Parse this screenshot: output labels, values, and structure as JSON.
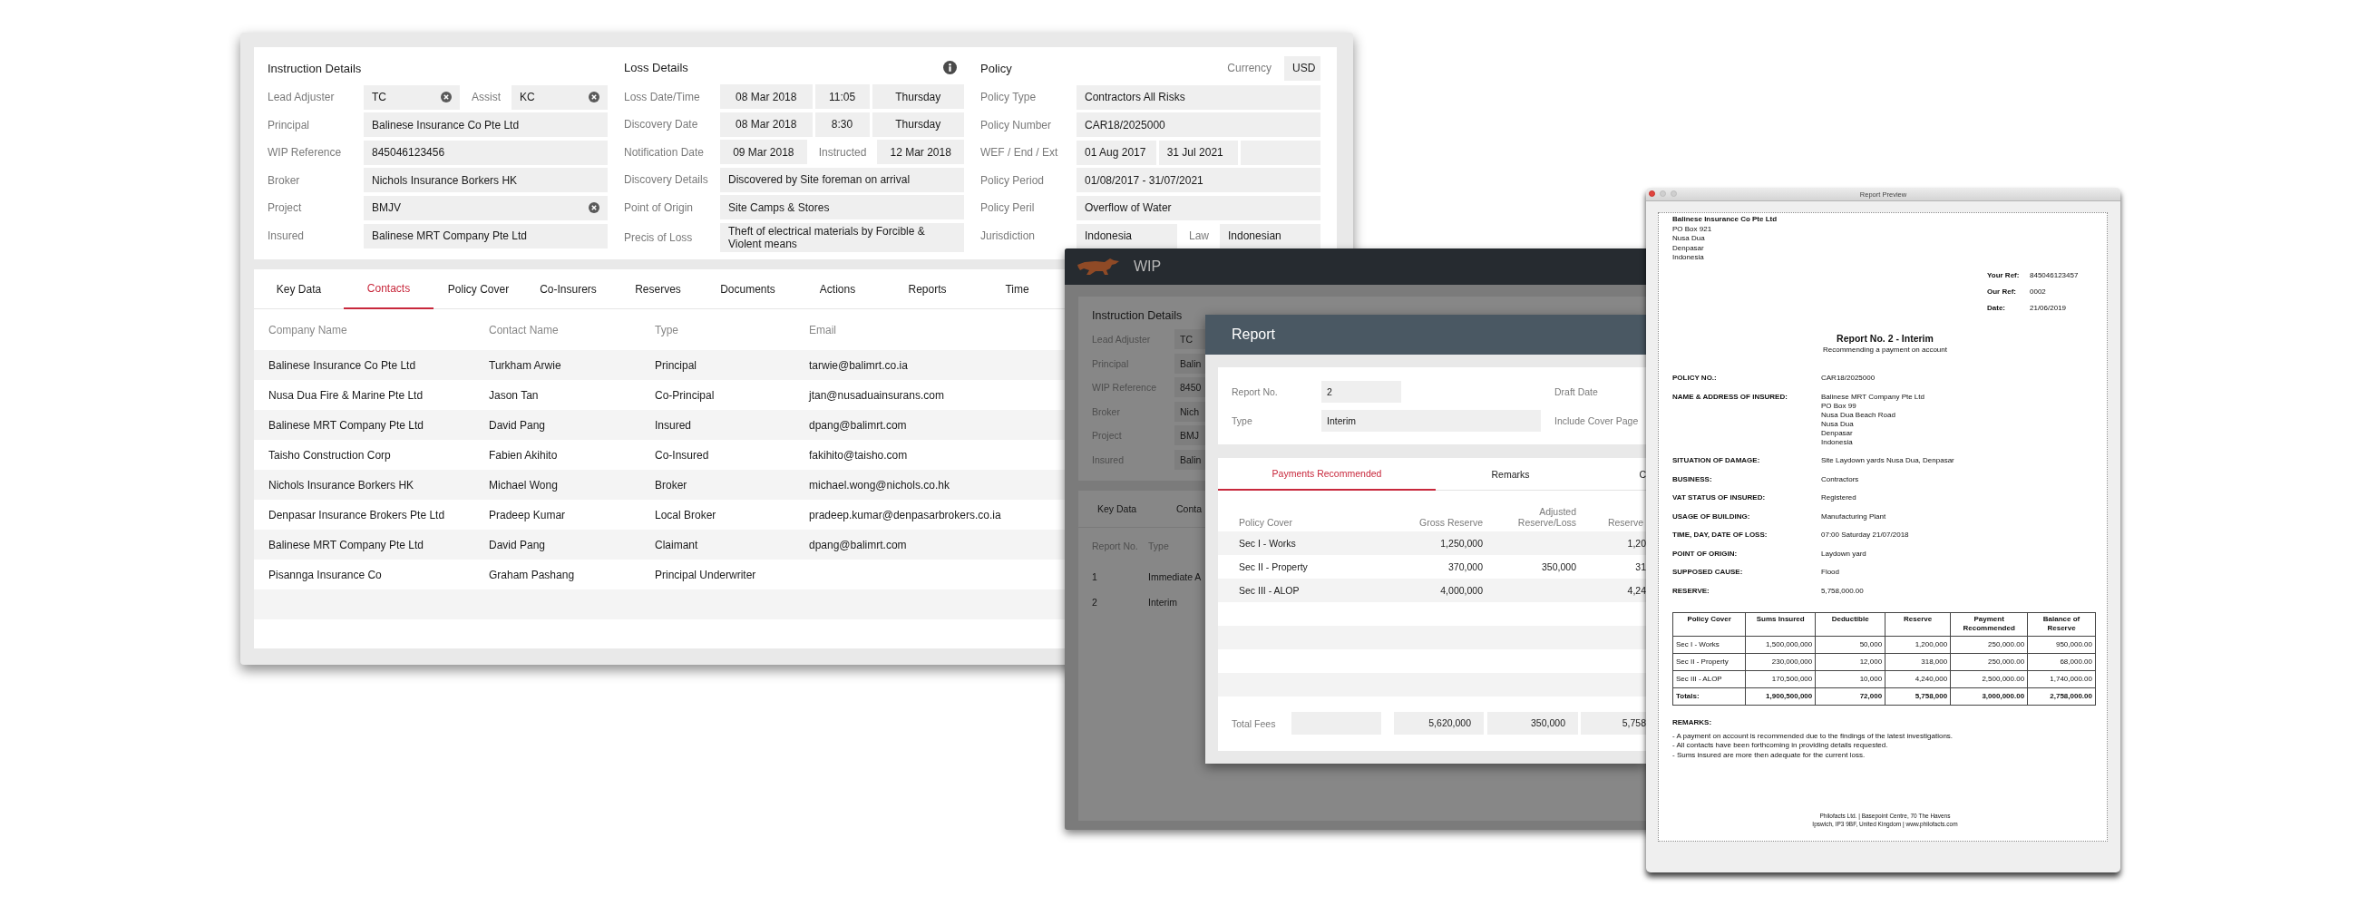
{
  "claim_window": {
    "sections": [
      {
        "kind": "instruction",
        "title": "Instruction Details",
        "rows": [
          {
            "label": "Lead Adjuster",
            "parts": [
              {
                "kind": "field",
                "value": "TC",
                "clearable": true
              },
              {
                "kind": "label",
                "text": "Assist"
              },
              {
                "kind": "field",
                "value": "KC",
                "clearable": true
              }
            ]
          },
          {
            "label": "Principal",
            "parts": [
              {
                "kind": "field",
                "value": "Balinese Insurance Co Pte Ltd",
                "clearable": false
              }
            ]
          },
          {
            "label": "WIP Reference",
            "parts": [
              {
                "kind": "field",
                "value": "845046123456",
                "clearable": false
              }
            ]
          },
          {
            "label": "Broker",
            "parts": [
              {
                "kind": "field",
                "value": "Nichols Insurance Borkers HK",
                "clearable": false
              }
            ]
          },
          {
            "label": "Project",
            "parts": [
              {
                "kind": "field",
                "value": "BMJV",
                "clearable": true
              }
            ]
          },
          {
            "label": "Insured",
            "parts": [
              {
                "kind": "field",
                "value": "Balinese MRT Company Pte Ltd",
                "clearable": false
              }
            ]
          }
        ]
      },
      {
        "kind": "loss",
        "title": "Loss Details",
        "header_extras": [
          {
            "kind": "info"
          }
        ],
        "rows": [
          {
            "label": "Loss Date/Time",
            "parts": [
              {
                "kind": "field",
                "value": "08 Mar 2018",
                "clearable": false
              },
              {
                "kind": "field",
                "value": "11:05",
                "clearable": false
              },
              {
                "kind": "field",
                "value": "Thursday",
                "clearable": false
              }
            ]
          },
          {
            "label": "Discovery Date",
            "parts": [
              {
                "kind": "field",
                "value": "08 Mar 2018",
                "clearable": false
              },
              {
                "kind": "field",
                "value": "8:30",
                "clearable": false
              },
              {
                "kind": "field",
                "value": "Thursday",
                "clearable": false
              }
            ]
          },
          {
            "label": "Notification Date",
            "parts": [
              {
                "kind": "field",
                "value": "09 Mar 2018",
                "clearable": false
              },
              {
                "kind": "label",
                "text": "Instructed"
              },
              {
                "kind": "field",
                "value": "12 Mar 2018",
                "clearable": false
              }
            ]
          },
          {
            "label": "Discovery Details",
            "parts": [
              {
                "kind": "field",
                "value": "Discovered by Site foreman on arrival",
                "clearable": false
              }
            ]
          },
          {
            "label": "Point of Origin",
            "parts": [
              {
                "kind": "field",
                "value": "Site Camps & Stores",
                "clearable": false
              }
            ]
          },
          {
            "label": "Precis of Loss",
            "parts": [
              {
                "kind": "field",
                "value": "Theft of electrical materials by Forcible & Violent means",
                "clearable": false
              }
            ]
          }
        ]
      },
      {
        "kind": "policy",
        "title": "Policy",
        "header_extras": [
          {
            "kind": "label",
            "text": "Currency"
          },
          {
            "kind": "field",
            "value": "USD",
            "clearable": false
          }
        ],
        "rows": [
          {
            "label": "Policy Type",
            "parts": [
              {
                "kind": "field",
                "value": "Contractors All Risks",
                "clearable": false
              }
            ]
          },
          {
            "label": "Policy Number",
            "parts": [
              {
                "kind": "field",
                "value": "CAR18/2025000",
                "clearable": false
              }
            ]
          },
          {
            "label": "WEF / End / Ext",
            "parts": [
              {
                "kind": "field",
                "value": "01 Aug 2017",
                "clearable": false
              },
              {
                "kind": "field",
                "value": "31 Jul 2021",
                "clearable": false
              },
              {
                "kind": "field",
                "clearable": false
              }
            ]
          },
          {
            "label": "Policy Period",
            "parts": [
              {
                "kind": "field",
                "value": "01/08/2017 - 31/07/2021",
                "clearable": false
              }
            ]
          },
          {
            "label": "Policy Peril",
            "parts": [
              {
                "kind": "field",
                "value": "Overflow of Water",
                "clearable": false
              }
            ]
          },
          {
            "label": "Jurisdiction",
            "parts": [
              {
                "kind": "field",
                "value": "Indonesia",
                "clearable": false
              },
              {
                "kind": "label",
                "text": "Law"
              },
              {
                "kind": "field",
                "value": "Indonesian",
                "clearable": false
              }
            ]
          }
        ]
      }
    ],
    "tabs": [
      {
        "label": "Key Data",
        "selected": false
      },
      {
        "label": "Contacts",
        "selected": true
      },
      {
        "label": "Policy Cover",
        "selected": false
      },
      {
        "label": "Co-Insurers",
        "selected": false
      },
      {
        "label": "Reserves",
        "selected": false
      },
      {
        "label": "Documents",
        "selected": false
      },
      {
        "label": "Actions",
        "selected": false
      },
      {
        "label": "Reports",
        "selected": false
      },
      {
        "label": "Time",
        "selected": false
      }
    ],
    "contacts_table": {
      "columns": [
        "Company Name",
        "Contact Name",
        "Type",
        "Email"
      ],
      "rows": [
        {
          "company": "Balinese Insurance Co Pte Ltd",
          "contact": "Turkham Arwie",
          "type": "Principal",
          "email": "tarwie@balimrt.co.ia"
        },
        {
          "company": "Nusa Dua Fire & Marine Pte Ltd",
          "contact": "Jason Tan",
          "type": "Co-Principal",
          "email": "jtan@nusaduainsurans.com"
        },
        {
          "company": "Balinese MRT Company Pte Ltd",
          "contact": "David Pang",
          "type": "Insured",
          "email": "dpang@balimrt.com"
        },
        {
          "company": "Taisho Construction Corp",
          "contact": "Fabien Akihito",
          "type": "Co-Insured",
          "email": "fakihito@taisho.com"
        },
        {
          "company": "Nichols Insurance Borkers HK",
          "contact": "Michael Wong",
          "type": "Broker",
          "email": "michael.wong@nichols.co.hk"
        },
        {
          "company": "Denpasar Insurance Brokers Pte Ltd",
          "contact": "Pradeep Kumar",
          "type": "Local Broker",
          "email": "pradeep.kumar@denpasarbrokers.co.ia"
        },
        {
          "company": "Balinese MRT Company Pte Ltd",
          "contact": "David Pang",
          "type": "Claimant",
          "email": "dpang@balimrt.com"
        },
        {
          "company": "Pisannga Insurance Co",
          "contact": "Graham Pashang",
          "type": "Principal Underwriter"
        }
      ]
    }
  },
  "wip_window": {
    "title": "WIP",
    "instruction_details": {
      "title": "Instruction Details",
      "rows": [
        {
          "label": "Lead Adjuster",
          "value": "TC"
        },
        {
          "label": "Principal",
          "value": "Balin"
        },
        {
          "label": "WIP Reference",
          "value": "8450"
        },
        {
          "label": "Broker",
          "value": "Nich"
        },
        {
          "label": "Project",
          "value": "BMJ"
        },
        {
          "label": "Insured",
          "value": "Balin"
        }
      ]
    },
    "tabs": [
      {
        "label": "Key Data",
        "selected": false
      },
      {
        "label": "Conta",
        "selected": false
      }
    ],
    "reports_table": {
      "columns": [
        "Report No.",
        "Type"
      ],
      "rows": [
        {
          "number": "1",
          "type": "Immediate A"
        },
        {
          "number": "2",
          "type": "Interim"
        }
      ]
    }
  },
  "report_dialog": {
    "title": "Report",
    "fields": [
      {
        "label": "Report No.",
        "value": "2"
      },
      {
        "label": "Type",
        "value": "Interim"
      }
    ],
    "side_labels": [
      "Draft Date",
      "Include Cover Page"
    ],
    "tabs": [
      {
        "label": "Payments Recommended",
        "selected": true
      },
      {
        "label": "Remarks",
        "selected": false
      },
      {
        "label": "C",
        "selected": false
      }
    ],
    "payments_table": {
      "columns": [
        "Policy Cover",
        "Gross Reserve",
        "Adjusted Reserve/Loss",
        "Reserve"
      ],
      "rows": [
        {
          "cover": "Sec I - Works",
          "gross": "1,250,000",
          "reserve": "1,20"
        },
        {
          "cover": "Sec II - Property",
          "gross": "370,000",
          "adjusted": "350,000",
          "reserve": "31"
        },
        {
          "cover": "Sec III - ALOP",
          "gross": "4,000,000",
          "reserve": "4,24"
        }
      ],
      "totals_label": "Total Fees",
      "totals": {
        "gross": "5,620,000",
        "adjusted": "350,000",
        "reserve": "5,758"
      }
    }
  },
  "report_preview": {
    "title": "Report Preview",
    "letterhead": [
      "Balinese Insurance Co Pte Ltd",
      "PO Box 921",
      "Nusa Dua",
      "Denpasar",
      "Indonesia"
    ],
    "references": [
      {
        "label": "Your Ref:",
        "value": "845046123457"
      },
      {
        "label": "Our Ref:",
        "value": "0002"
      },
      {
        "label": "Date:",
        "value": "21/06/2019"
      }
    ],
    "heading": "Report No. 2 - Interim",
    "subheading": "Recommending a payment on account",
    "details": [
      {
        "label": "POLICY NO.:",
        "lines": [
          "CAR18/2025000"
        ]
      },
      {
        "label": "NAME & ADDRESS OF INSURED:",
        "lines": [
          "Balinese MRT Company Pte Ltd",
          "PO Box 99",
          "Nusa Dua Beach Road",
          "Nusa Dua",
          "Denpasar",
          "Indonesia"
        ]
      },
      {
        "label": "SITUATION OF DAMAGE:",
        "lines": [
          "Site Laydown yards Nusa Dua, Denpasar"
        ]
      },
      {
        "label": "BUSINESS:",
        "lines": [
          "Contractors"
        ]
      },
      {
        "label": "VAT STATUS OF INSURED:",
        "lines": [
          "Registered"
        ]
      },
      {
        "label": "USAGE OF BUILDING:",
        "lines": [
          "Manufacturing Plant"
        ]
      },
      {
        "label": "TIME, DAY, DATE OF LOSS:",
        "lines": [
          "07:00 Saturday 21/07/2018"
        ]
      },
      {
        "label": "POINT OF ORIGIN:",
        "lines": [
          "Laydown yard"
        ]
      },
      {
        "label": "SUPPOSED CAUSE:",
        "lines": [
          "Flood"
        ]
      },
      {
        "label": "RESERVE:",
        "lines": [
          "5,758,000.00"
        ]
      }
    ],
    "cover_table": {
      "columns": [
        "Policy Cover",
        "Sums Insured",
        "Deductible",
        "Reserve",
        "Payment Recommended",
        "Balance of Reserve"
      ],
      "rows": [
        [
          "Sec I - Works",
          "1,500,000,000",
          "50,000",
          "1,200,000",
          "250,000.00",
          "950,000.00"
        ],
        [
          "Sec II - Property",
          "230,000,000",
          "12,000",
          "318,000",
          "250,000.00",
          "68,000.00"
        ],
        [
          "Sec III - ALOP",
          "170,500,000",
          "10,000",
          "4,240,000",
          "2,500,000.00",
          "1,740,000.00"
        ]
      ],
      "totals": [
        "Totals:",
        "1,900,500,000",
        "72,000",
        "5,758,000",
        "3,000,000.00",
        "2,758,000.00"
      ]
    },
    "remarks_heading": "REMARKS:",
    "remarks": [
      "- A payment on account is recommended due to the findings of the latest investigations.",
      "- All contacts have been forthcoming in providing details requested.",
      "- Sums insured are more then adequate for the current loss."
    ],
    "footer": [
      "Philofacts Ltd. | Basepoint Centre, 70 The Havens",
      "Ipswich, IP3 9BF, United Kingdom | www.philofacts.com"
    ]
  }
}
